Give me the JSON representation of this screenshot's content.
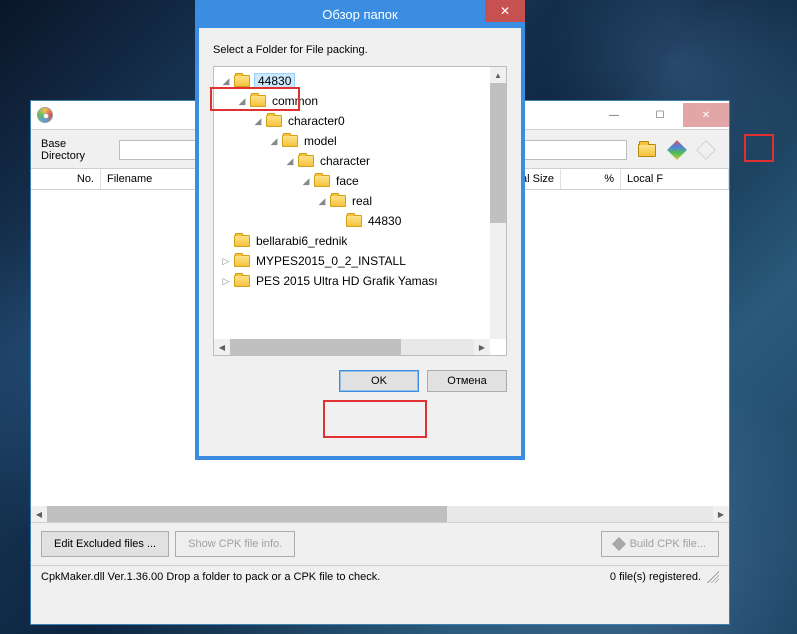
{
  "main": {
    "base_dir_label": "Base Directory",
    "columns": {
      "no": "No.",
      "filename": "Filename",
      "original_size": "Original Size",
      "percent": "%",
      "local": "Local F"
    },
    "buttons": {
      "edit_excluded": "Edit Excluded files ...",
      "show_info": "Show CPK file info.",
      "build": "Build CPK file..."
    },
    "status_left": "CpkMaker.dll Ver.1.36.00  Drop a folder to pack or a CPK file to check.",
    "status_right": "0 file(s) registered."
  },
  "dialog": {
    "title": "Обзор папок",
    "instruction": "Select a Folder for File packing.",
    "ok": "OK",
    "cancel": "Отмена",
    "tree": [
      {
        "depth": 0,
        "exp": "◢",
        "label": "44830",
        "selected": true
      },
      {
        "depth": 1,
        "exp": "◢",
        "label": "common"
      },
      {
        "depth": 2,
        "exp": "◢",
        "label": "character0"
      },
      {
        "depth": 3,
        "exp": "◢",
        "label": "model"
      },
      {
        "depth": 4,
        "exp": "◢",
        "label": "character"
      },
      {
        "depth": 5,
        "exp": "◢",
        "label": "face"
      },
      {
        "depth": 6,
        "exp": "◢",
        "label": "real"
      },
      {
        "depth": 7,
        "exp": "",
        "label": "44830"
      },
      {
        "depth": 0,
        "exp": "",
        "label": "bellarabi6_rednik"
      },
      {
        "depth": 0,
        "exp": "▷",
        "label": "MYPES2015_0_2_INSTALL"
      },
      {
        "depth": 0,
        "exp": "▷",
        "label": "PES 2015 Ultra HD Grafik Yaması"
      }
    ]
  }
}
